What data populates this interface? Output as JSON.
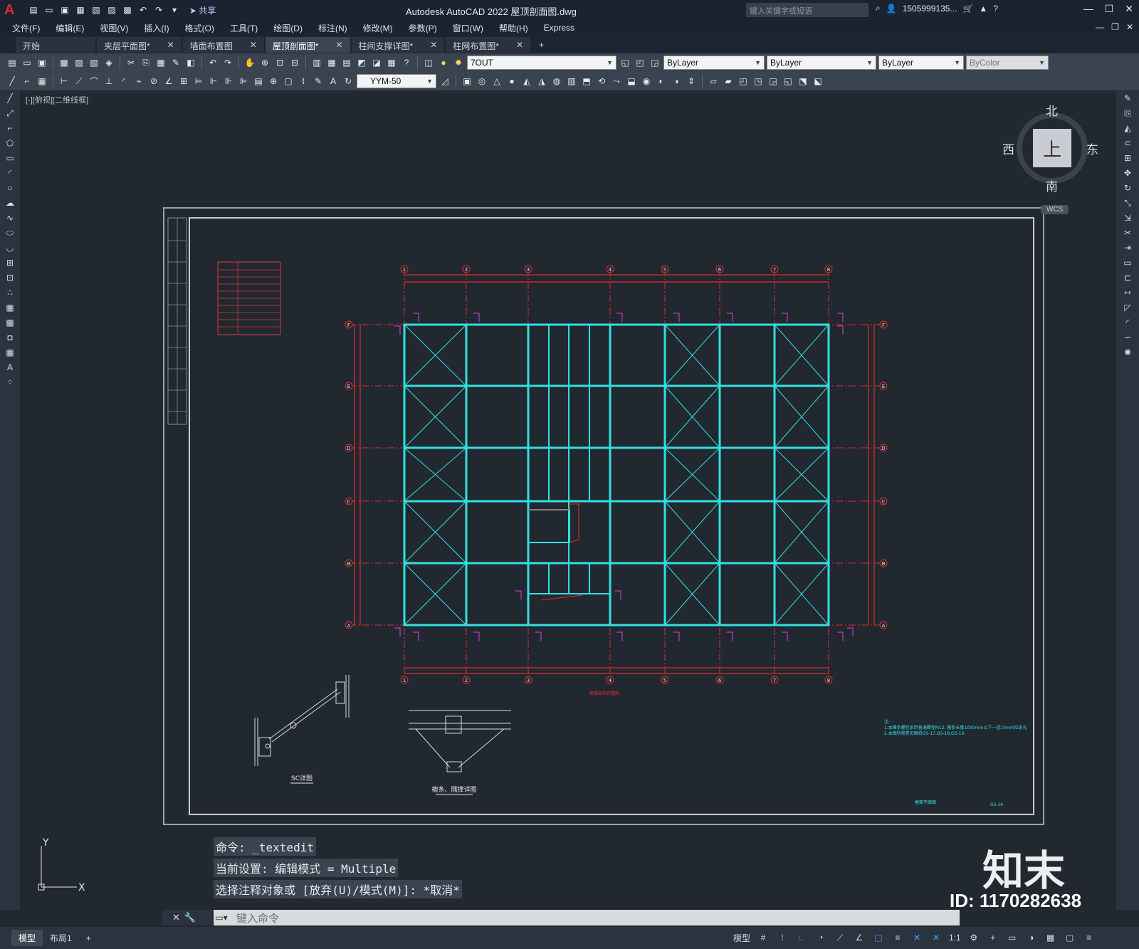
{
  "app": {
    "title": "Autodesk AutoCAD 2022    屋顶剖面图.dwg",
    "share": "共享",
    "search_placeholder": "键入关键字或短语",
    "user": "1505999135...",
    "logo": "A"
  },
  "menu": [
    "文件(F)",
    "编辑(E)",
    "视图(V)",
    "插入(I)",
    "格式(O)",
    "工具(T)",
    "绘图(D)",
    "标注(N)",
    "修改(M)",
    "参数(P)",
    "窗口(W)",
    "帮助(H)",
    "Express"
  ],
  "tabs": [
    {
      "label": "开始",
      "active": false
    },
    {
      "label": "夹层平面图*",
      "active": false
    },
    {
      "label": "墙面布置图",
      "active": false
    },
    {
      "label": "屋顶剖面图*",
      "active": true
    },
    {
      "label": "柱间支撑详图*",
      "active": false
    },
    {
      "label": "柱网布置图*",
      "active": false
    }
  ],
  "properties": {
    "layer": "7OUT",
    "color": "ByLayer",
    "linetype": "ByLayer",
    "lineweight": "ByLayer",
    "plotstyle": "ByColor",
    "dimstyle": "YYM-50"
  },
  "viewport_label": "[-][俯视][二维线框]",
  "viewcube": {
    "north": "北",
    "south": "南",
    "east": "东",
    "west": "西",
    "top": "上",
    "wcs": "WCS"
  },
  "drawing": {
    "grid_cols": [
      "1",
      "2",
      "3",
      "4",
      "5",
      "6",
      "7",
      "8"
    ],
    "grid_rows": [
      "F",
      "E",
      "D",
      "C",
      "B",
      "A"
    ],
    "detail1_title": "SC详图",
    "detail2_title": "檩条、隅撑详图",
    "note_line1": "注:",
    "note_line2": "1.本檩条螺栓采用普通螺栓M12, 檩条长度1000mm以下一道10mm拉条孔",
    "note_line3": "2.本图所需参见图纸GS-17,GS-18,GS-19.",
    "plan_title": "屋面结构布置图",
    "sheet_no": "GS-16",
    "bottom_title": "屋面平面图"
  },
  "command_history": [
    "命令: _textedit",
    "当前设置: 编辑模式 = Multiple",
    "选择注释对象或 [放弃(U)/模式(M)]: *取消*"
  ],
  "command_placeholder": "键入命令",
  "layouts": [
    {
      "label": "模型",
      "active": true
    },
    {
      "label": "布局1",
      "active": false
    }
  ],
  "status": {
    "model": "模型",
    "scale": "1:1"
  },
  "watermark": {
    "logo": "知末",
    "id": "ID: 1170282638"
  },
  "ucs": {
    "x": "X",
    "y": "Y"
  }
}
